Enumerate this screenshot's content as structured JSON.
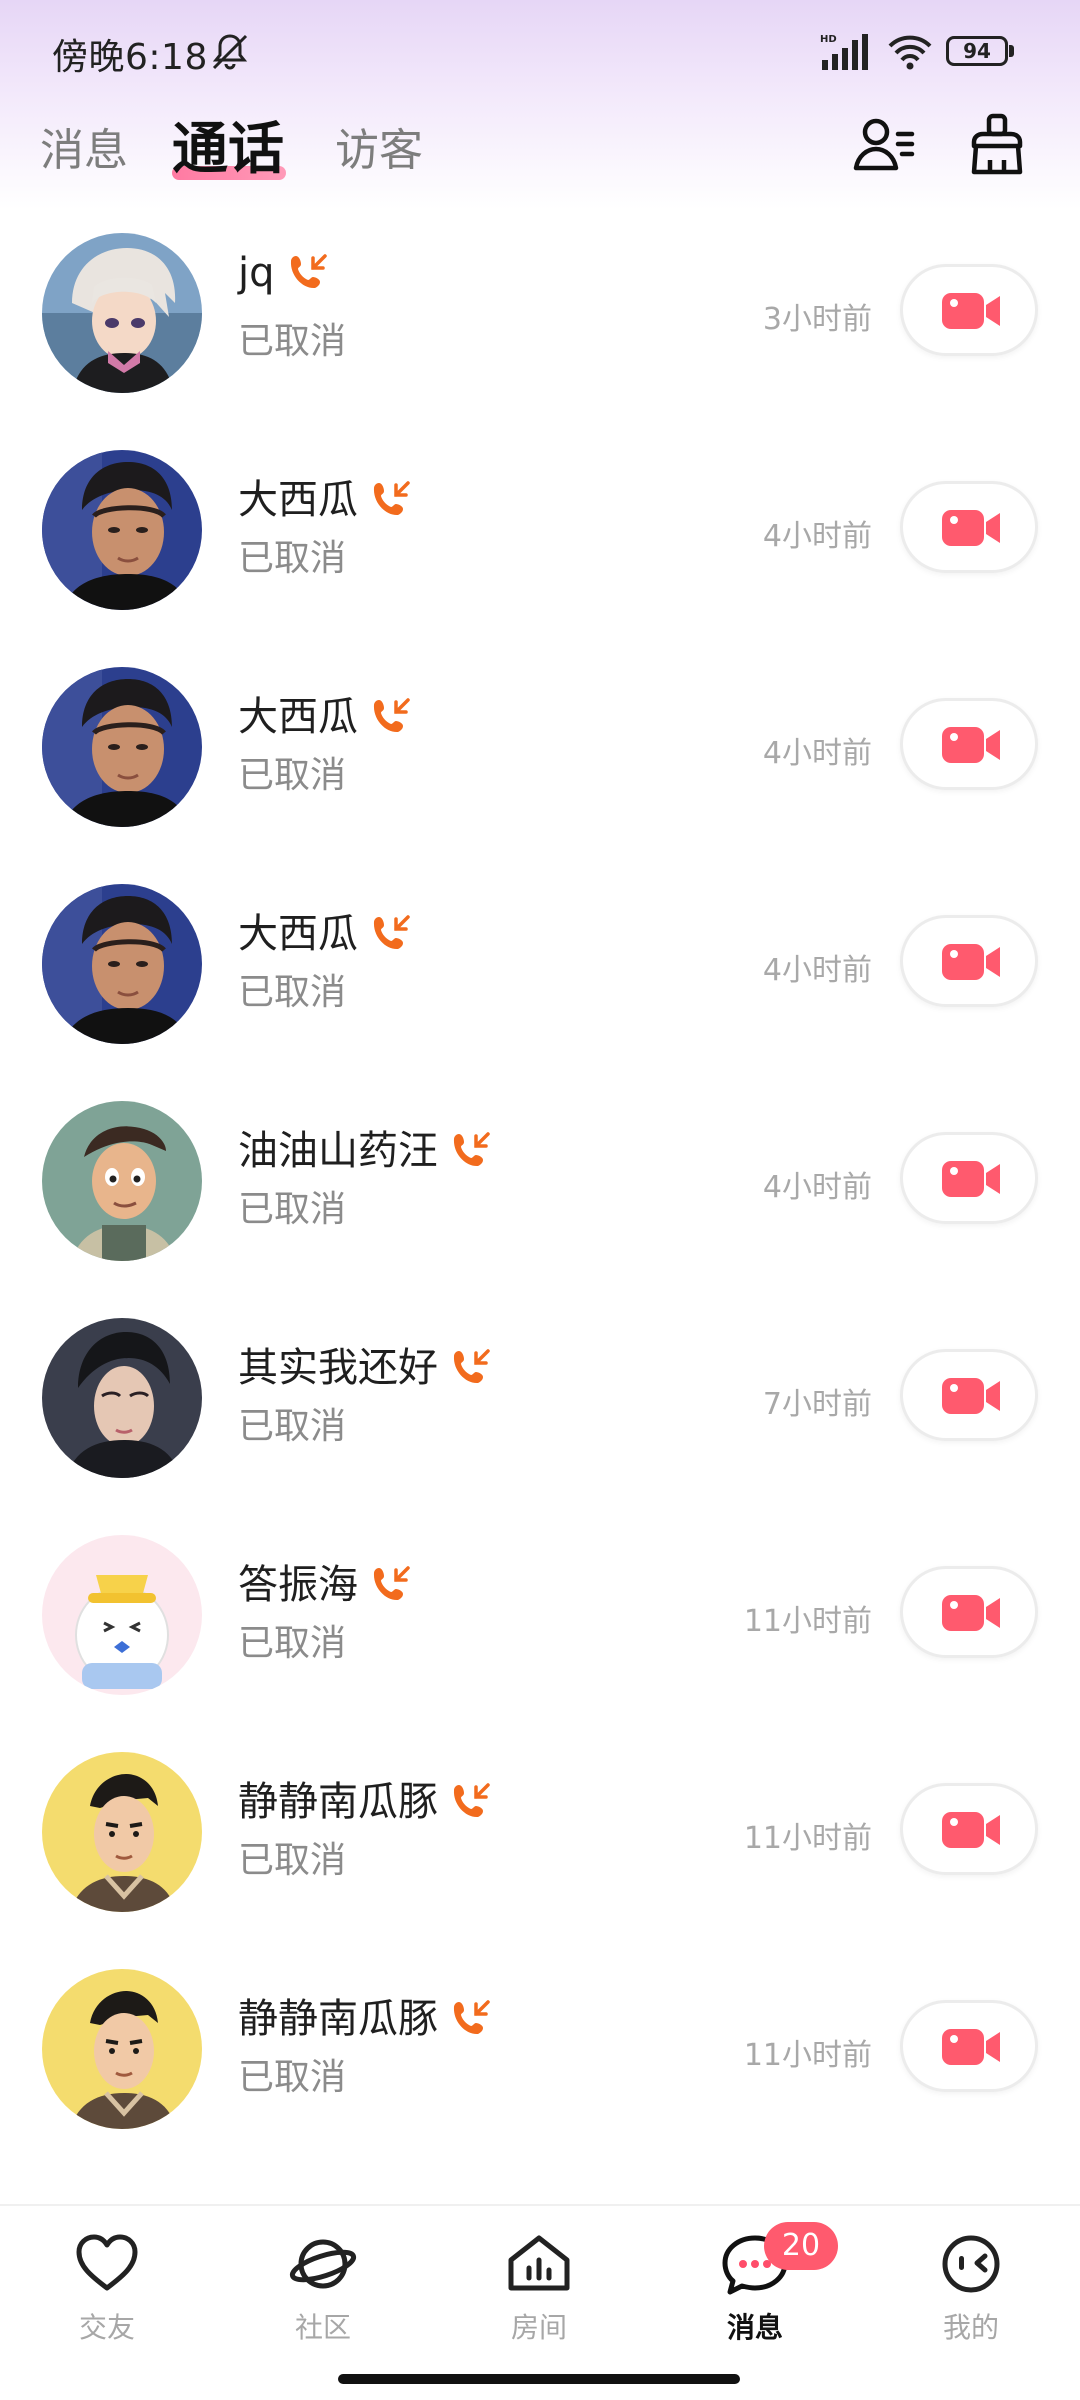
{
  "status_bar": {
    "time": "傍晚6:18",
    "battery": "94"
  },
  "header": {
    "tabs": [
      {
        "label": "消息",
        "active": false
      },
      {
        "label": "通话",
        "active": true
      },
      {
        "label": "访客",
        "active": false
      }
    ],
    "icons": [
      "contacts-icon",
      "clear-broom-icon"
    ],
    "accent_color": "#ff7aa2"
  },
  "calls": [
    {
      "name": "jq",
      "status": "已取消",
      "time": "3小时前",
      "avatar": "anime-white-hair"
    },
    {
      "name": "大西瓜",
      "status": "已取消",
      "time": "4小时前",
      "avatar": "man-photo"
    },
    {
      "name": "大西瓜",
      "status": "已取消",
      "time": "4小时前",
      "avatar": "man-photo"
    },
    {
      "name": "大西瓜",
      "status": "已取消",
      "time": "4小时前",
      "avatar": "man-photo"
    },
    {
      "name": "油油山药汪",
      "status": "已取消",
      "time": "4小时前",
      "avatar": "cartoon-man-green"
    },
    {
      "name": "其实我还好",
      "status": "已取消",
      "time": "7小时前",
      "avatar": "illustrated-man-dark"
    },
    {
      "name": "答振海",
      "status": "已取消",
      "time": "11小时前",
      "avatar": "cartoon-egg-hat"
    },
    {
      "name": "静静南瓜豚",
      "status": "已取消",
      "time": "11小时前",
      "avatar": "cartoon-man-yellow"
    },
    {
      "name": "静静南瓜豚",
      "status": "已取消",
      "time": "11小时前",
      "avatar": "cartoon-man-yellow"
    }
  ],
  "call_icon_color": "#f26b1d",
  "video_icon_color": "#ff5a6e",
  "bottom_nav": {
    "items": [
      {
        "label": "交友",
        "icon": "heart-icon",
        "active": false
      },
      {
        "label": "社区",
        "icon": "planet-icon",
        "active": false
      },
      {
        "label": "房间",
        "icon": "house-chart-icon",
        "active": false
      },
      {
        "label": "消息",
        "icon": "chat-bubble-icon",
        "active": true,
        "badge": "20"
      },
      {
        "label": "我的",
        "icon": "face-icon",
        "active": false
      }
    ]
  }
}
